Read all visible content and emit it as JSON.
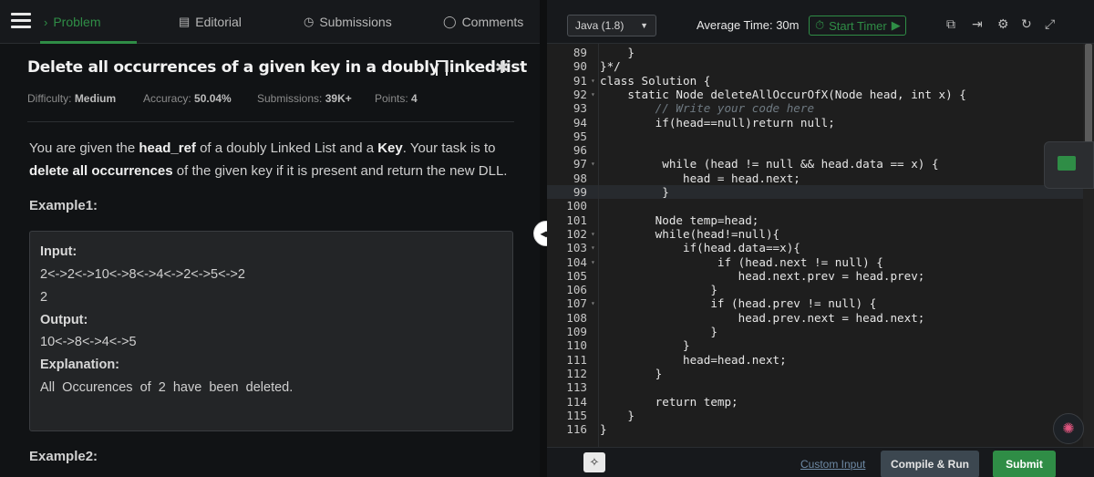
{
  "nav": {
    "tabs": [
      {
        "label": "Problem",
        "icon": "chevron-right-icon",
        "active": true
      },
      {
        "label": "Editorial",
        "icon": "document-icon"
      },
      {
        "label": "Submissions",
        "icon": "clock-icon"
      },
      {
        "label": "Comments",
        "icon": "chat-icon"
      }
    ]
  },
  "problem": {
    "title": "Delete all occurrences of a given key in a doubly linked list",
    "difficulty_label": "Difficulty:",
    "difficulty": "Medium",
    "accuracy_label": "Accuracy:",
    "accuracy": "50.04%",
    "submissions_label": "Submissions:",
    "submissions": "39K+",
    "points_label": "Points:",
    "points": "4",
    "desc_1": "You are given the ",
    "desc_b1": "head_ref",
    "desc_2": " of a doubly Linked List and a ",
    "desc_b2": "Key",
    "desc_3": ". Your task is to",
    "desc_b3": "delete all occurrences",
    "desc_4": " of the given key if it is present and return the new DLL.",
    "example1": "Example1:",
    "example2": "Example2:",
    "input_label": "Input:",
    "input_list": "2<->2<->10<->8<->4<->2<->5<->2",
    "input_key": "2",
    "output_label": "Output:",
    "output_value": "10<->8<->4<->5",
    "explanation_label": "Explanation:",
    "explanation": "All  Occurences  of  2  have  been  deleted."
  },
  "editor": {
    "language": "Java (1.8)",
    "average_time": "Average Time: 30m",
    "start_timer": "Start Timer",
    "lines": [
      {
        "n": "89",
        "code": "    }"
      },
      {
        "n": "90",
        "code": "}*/"
      },
      {
        "n": "91",
        "code": "class Solution {"
      },
      {
        "n": "92",
        "code": "    static Node deleteAllOccurOfX(Node head, int x) {"
      },
      {
        "n": "93",
        "code": "        // Write your code here"
      },
      {
        "n": "94",
        "code": "        if(head==null)return null;"
      },
      {
        "n": "95",
        "code": ""
      },
      {
        "n": "96",
        "code": ""
      },
      {
        "n": "97",
        "code": "         while (head != null && head.data == x) {"
      },
      {
        "n": "98",
        "code": "            head = head.next;"
      },
      {
        "n": "99",
        "code": "         }"
      },
      {
        "n": "100",
        "code": ""
      },
      {
        "n": "101",
        "code": "        Node temp=head;"
      },
      {
        "n": "102",
        "code": "        while(head!=null){"
      },
      {
        "n": "103",
        "code": "            if(head.data==x){"
      },
      {
        "n": "104",
        "code": "                 if (head.next != null) {"
      },
      {
        "n": "105",
        "code": "                    head.next.prev = head.prev;"
      },
      {
        "n": "106",
        "code": "                }"
      },
      {
        "n": "107",
        "code": "                if (head.prev != null) {"
      },
      {
        "n": "108",
        "code": "                    head.prev.next = head.next;"
      },
      {
        "n": "109",
        "code": "                }"
      },
      {
        "n": "110",
        "code": "            }"
      },
      {
        "n": "111",
        "code": "            head=head.next;"
      },
      {
        "n": "112",
        "code": "        }"
      },
      {
        "n": "113",
        "code": ""
      },
      {
        "n": "114",
        "code": "        return temp;"
      },
      {
        "n": "115",
        "code": "    }"
      },
      {
        "n": "116",
        "code": "}"
      }
    ],
    "custom_input": "Custom Input",
    "compile_run": "Compile & Run",
    "submit": "Submit"
  },
  "colors": {
    "accent": "#2f8d46",
    "bg": "#1e1e1e"
  }
}
